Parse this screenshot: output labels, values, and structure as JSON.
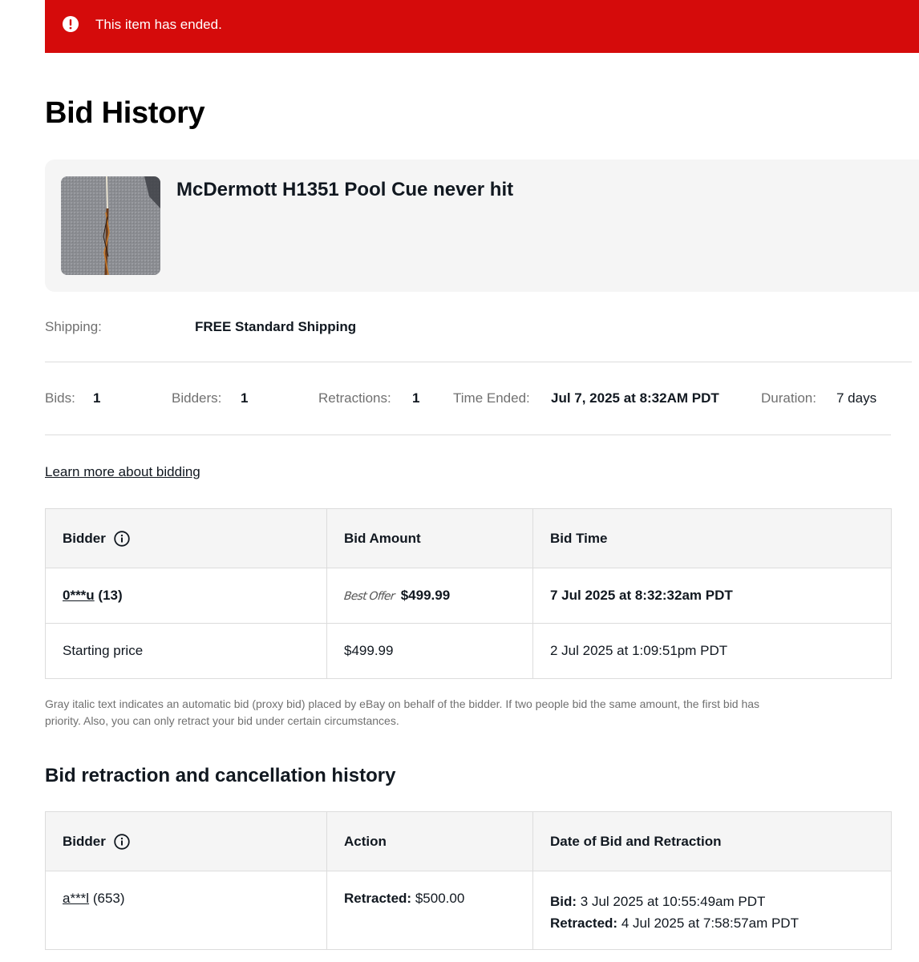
{
  "banner": {
    "message": "This item has ended.",
    "color": "#d50b0b",
    "icon": "alert-circle-icon"
  },
  "page": {
    "title": "Bid History"
  },
  "item": {
    "title": "McDermott H1351 Pool Cue never hit",
    "thumbnail": "pool-cue-photo"
  },
  "shipping": {
    "label": "Shipping:",
    "value": "FREE Standard Shipping"
  },
  "stats": {
    "bids_label": "Bids:",
    "bids_value": "1",
    "bidders_label": "Bidders:",
    "bidders_value": "1",
    "retractions_label": "Retractions:",
    "retractions_value": "1",
    "time_ended_label": "Time Ended:",
    "time_ended_value": "Jul 7, 2025 at 8:32AM PDT",
    "duration_label": "Duration:",
    "duration_value": "7 days"
  },
  "learn_more": "Learn more about bidding",
  "bid_table": {
    "headers": [
      "Bidder",
      "Bid Amount",
      "Bid Time"
    ],
    "rows": [
      {
        "bidder": "0***u",
        "feedback": "(13)",
        "tag": "Best Offer",
        "amount": "$499.99",
        "time": "7 Jul 2025 at 8:32:32am PDT"
      },
      {
        "bidder": "Starting price",
        "amount": "$499.99",
        "time": "2 Jul 2025 at 1:09:51pm PDT"
      }
    ]
  },
  "note": "Gray italic text indicates an automatic bid (proxy bid) placed by eBay on behalf of the bidder. If two people bid the same amount, the first bid has priority. Also, you can only retract your bid under certain circumstances.",
  "retraction": {
    "title": "Bid retraction and cancellation history",
    "headers": [
      "Bidder",
      "Action",
      "Date of Bid and Retraction"
    ],
    "rows": [
      {
        "bidder": "a***l",
        "feedback": "(653)",
        "action_label": "Retracted:",
        "action_amount": "$500.00",
        "bid_label": "Bid:",
        "bid_date": "3 Jul 2025 at 10:55:49am PDT",
        "retracted_label": "Retracted:",
        "retracted_date": "4 Jul 2025 at 7:58:57am PDT"
      }
    ]
  }
}
